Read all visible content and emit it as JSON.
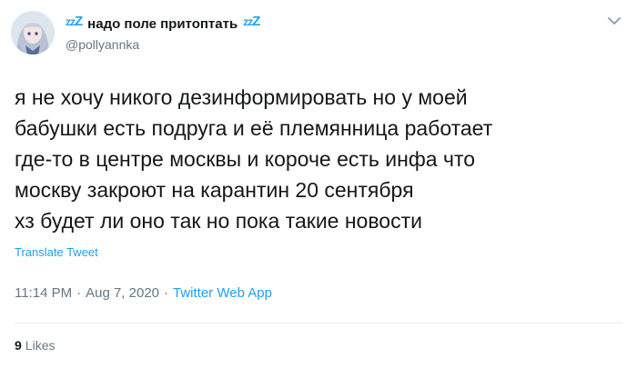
{
  "tweet": {
    "display_name": "надо поле притоптать",
    "name_deco_left": [
      "z",
      "z",
      "Z"
    ],
    "name_deco_right": [
      "z",
      "z",
      "Z"
    ],
    "handle": "@pollyannka",
    "text_lines": [
      "я не хочу никого дезинформировать но у моей",
      "бабушки есть подруга и её племянница работает",
      "где-то в центре москвы и короче есть инфа что",
      "москву закроют на карантин 20 сентября",
      "хз будет ли оно так но пока такие новости"
    ],
    "translate_label": "Translate Tweet",
    "time": "11:14 PM",
    "separator": "·",
    "date": "Aug 7, 2020",
    "source": "Twitter Web App",
    "likes_count": "9",
    "likes_label": "Likes"
  },
  "colors": {
    "accent": "#1da1f2",
    "text": "#14171a",
    "muted": "#657786",
    "divider": "#e6ecf0"
  },
  "icons": {
    "menu": "chevron-down-icon",
    "avatar": "anime-avatar-icon"
  }
}
